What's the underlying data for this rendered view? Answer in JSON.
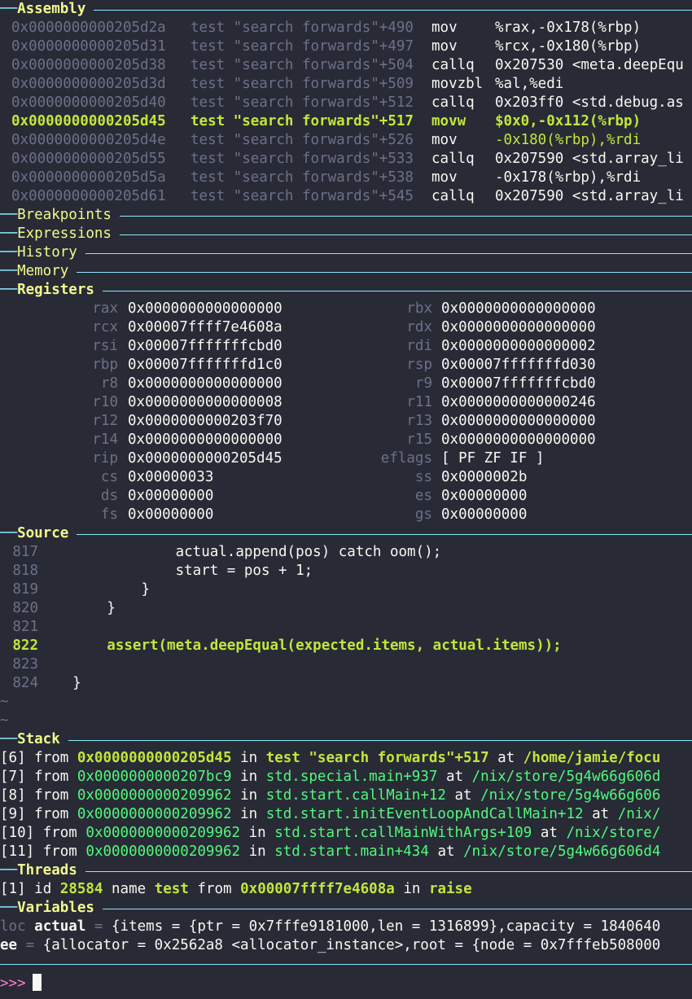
{
  "sections": {
    "assembly": "Assembly",
    "breakpoints": "Breakpoints",
    "expressions": "Expressions",
    "history": "History",
    "memory": "Memory",
    "registers": "Registers",
    "source": "Source",
    "stack": "Stack",
    "threads": "Threads",
    "variables": "Variables"
  },
  "assembly": [
    {
      "addr": "0x0000000000205d2a",
      "fn": "test \"search forwards\"+490",
      "op": "mov",
      "args": "%rax,-0x178(%rbp)",
      "current": false
    },
    {
      "addr": "0x0000000000205d31",
      "fn": "test \"search forwards\"+497",
      "op": "mov",
      "args": "%rcx,-0x180(%rbp)",
      "current": false
    },
    {
      "addr": "0x0000000000205d38",
      "fn": "test \"search forwards\"+504",
      "op": "callq",
      "args": "0x207530 <meta.deepEqu",
      "current": false
    },
    {
      "addr": "0x0000000000205d3d",
      "fn": "test \"search forwards\"+509",
      "op": "movzbl",
      "args": "%al,%edi",
      "current": false
    },
    {
      "addr": "0x0000000000205d40",
      "fn": "test \"search forwards\"+512",
      "op": "callq",
      "args": "0x203ff0 <std.debug.as",
      "current": false
    },
    {
      "addr": "0x0000000000205d45",
      "fn": "test \"search forwards\"+517",
      "op": "movw",
      "args": "$0x0,-0x112(%rbp)",
      "current": true
    },
    {
      "addr": "0x0000000000205d4e",
      "fn": "test \"search forwards\"+526",
      "op": "mov",
      "args": "-0x180(%rbp),%rdi",
      "current": false
    },
    {
      "addr": "0x0000000000205d55",
      "fn": "test \"search forwards\"+533",
      "op": "callq",
      "args": "0x207590 <std.array_li",
      "current": false
    },
    {
      "addr": "0x0000000000205d5a",
      "fn": "test \"search forwards\"+538",
      "op": "mov",
      "args": "-0x178(%rbp),%rdi",
      "current": false
    },
    {
      "addr": "0x0000000000205d61",
      "fn": "test \"search forwards\"+545",
      "op": "callq",
      "args": "0x207590 <std.array_li",
      "current": false
    }
  ],
  "registers": [
    {
      "n1": "rax",
      "v1": "0x0000000000000000",
      "n2": "rbx",
      "v2": "0x0000000000000000"
    },
    {
      "n1": "rcx",
      "v1": "0x00007ffff7e4608a",
      "n2": "rdx",
      "v2": "0x0000000000000000"
    },
    {
      "n1": "rsi",
      "v1": "0x00007fffffffcbd0",
      "n2": "rdi",
      "v2": "0x0000000000000002"
    },
    {
      "n1": "rbp",
      "v1": "0x00007fffffffd1c0",
      "n2": "rsp",
      "v2": "0x00007fffffffd030"
    },
    {
      "n1": "r8",
      "v1": "0x0000000000000000",
      "n2": "r9",
      "v2": "0x00007fffffffcbd0"
    },
    {
      "n1": "r10",
      "v1": "0x0000000000000008",
      "n2": "r11",
      "v2": "0x0000000000000246"
    },
    {
      "n1": "r12",
      "v1": "0x0000000000203f70",
      "n2": "r13",
      "v2": "0x0000000000000000"
    },
    {
      "n1": "r14",
      "v1": "0x0000000000000000",
      "n2": "r15",
      "v2": "0x0000000000000000"
    },
    {
      "n1": "rip",
      "v1": "0x0000000000205d45",
      "n2": "eflags",
      "v2": "[ PF ZF IF ]"
    },
    {
      "n1": "cs",
      "v1": "0x00000033",
      "n2": "ss",
      "v2": "0x0000002b"
    },
    {
      "n1": "ds",
      "v1": "0x00000000",
      "n2": "es",
      "v2": "0x00000000"
    },
    {
      "n1": "fs",
      "v1": "0x00000000",
      "n2": "gs",
      "v2": "0x00000000"
    }
  ],
  "source": [
    {
      "num": "817",
      "code": "            actual.append(pos) catch oom();",
      "current": false
    },
    {
      "num": "818",
      "code": "            start = pos + 1;",
      "current": false
    },
    {
      "num": "819",
      "code": "        }",
      "current": false
    },
    {
      "num": "820",
      "code": "    }",
      "current": false
    },
    {
      "num": "821",
      "code": "",
      "current": false
    },
    {
      "num": "822",
      "code": "    assert(meta.deepEqual(expected.items, actual.items));",
      "current": true
    },
    {
      "num": "823",
      "code": "",
      "current": false
    },
    {
      "num": "824",
      "code": "}",
      "current": false
    }
  ],
  "tildes": [
    "~",
    "~"
  ],
  "stack": [
    {
      "idx": "[6]",
      "from": "from",
      "addr": "0x0000000000205d45",
      "in": "in",
      "func": "test \"search forwards\"+517",
      "at": "at",
      "path": "/home/jamie/focu",
      "current": true
    },
    {
      "idx": "[7]",
      "from": "from",
      "addr": "0x0000000000207bc9",
      "in": "in",
      "func": "std.special.main+937",
      "at": "at",
      "path": "/nix/store/5g4w66g606d",
      "current": false
    },
    {
      "idx": "[8]",
      "from": "from",
      "addr": "0x0000000000209962",
      "in": "in",
      "func": "std.start.callMain+12",
      "at": "at",
      "path": "/nix/store/5g4w66g606",
      "current": false
    },
    {
      "idx": "[9]",
      "from": "from",
      "addr": "0x0000000000209962",
      "in": "in",
      "func": "std.start.initEventLoopAndCallMain+12",
      "at": "at",
      "path": "/nix/",
      "current": false
    },
    {
      "idx": "[10]",
      "from": "from",
      "addr": "0x0000000000209962",
      "in": "in",
      "func": "std.start.callMainWithArgs+109",
      "at": "at",
      "path": "/nix/store/",
      "current": false
    },
    {
      "idx": "[11]",
      "from": "from",
      "addr": "0x0000000000209962",
      "in": "in",
      "func": "std.start.main+434",
      "at": "at",
      "path": "/nix/store/5g4w66g606d4",
      "current": false
    }
  ],
  "threads": [
    {
      "idx": "[1]",
      "id_label": "id",
      "id": "28584",
      "name_label": "name",
      "name": "test",
      "from": "from",
      "addr": "0x00007ffff7e4608a",
      "in": "in",
      "func": "raise"
    }
  ],
  "variables": [
    {
      "scope": "loc",
      "name": "actual",
      "eq": "=",
      "value": "{items = {ptr = 0x7fffe9181000,len = 1316899},capacity = 1840640"
    },
    {
      "scope": "",
      "name": "ee",
      "eq": "=",
      "value": "{allocator = 0x2562a8 <allocator_instance>,root = {node = 0x7fffeb508000"
    }
  ],
  "prompt": ">>>"
}
